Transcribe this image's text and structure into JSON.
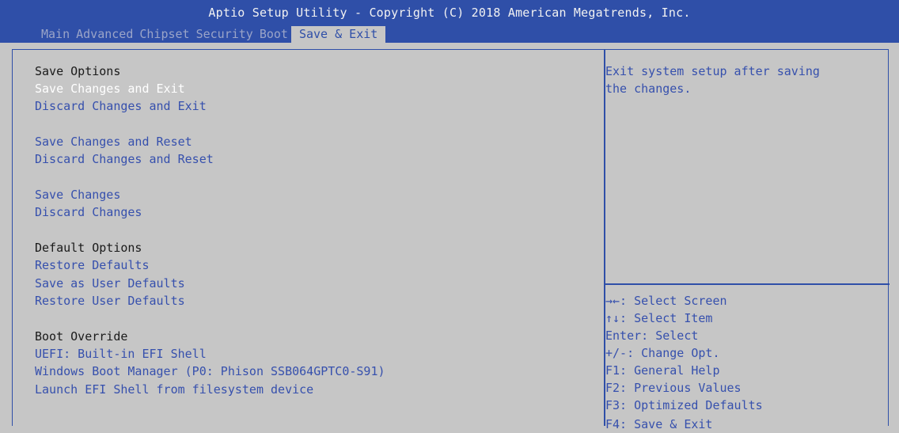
{
  "app": {
    "title": "Aptio Setup Utility - Copyright (C) 2018 American Megatrends, Inc."
  },
  "tabs": [
    {
      "label": "Main"
    },
    {
      "label": "Advanced"
    },
    {
      "label": "Chipset"
    },
    {
      "label": "Security"
    },
    {
      "label": "Boot"
    },
    {
      "label": "Save & Exit",
      "active": true
    }
  ],
  "menu": {
    "save_options_header": "Save Options",
    "save_changes_and_exit": "Save Changes and Exit",
    "discard_changes_and_exit": "Discard Changes and Exit",
    "save_changes_and_reset": "Save Changes and Reset",
    "discard_changes_and_reset": "Discard Changes and Reset",
    "save_changes": "Save Changes",
    "discard_changes": "Discard Changes",
    "default_options_header": "Default Options",
    "restore_defaults": "Restore Defaults",
    "save_as_user_defaults": "Save as User Defaults",
    "restore_user_defaults": "Restore User Defaults",
    "boot_override_header": "Boot Override",
    "uefi_builtin_efi_shell": "UEFI: Built-in EFI Shell",
    "windows_boot_manager": "Windows Boot Manager (P0: Phison SSB064GPTC0-S91)",
    "launch_efi_shell": "Launch EFI Shell from filesystem device"
  },
  "help": {
    "text": "Exit system setup after saving\nthe changes."
  },
  "keys": [
    "→←: Select Screen",
    "↑↓: Select Item",
    "Enter: Select",
    "+/-: Change Opt.",
    "F1: General Help",
    "F2: Previous Values",
    "F3: Optimized Defaults",
    "F4: Save & Exit"
  ],
  "colors": {
    "header_blue": "#2f4fa8",
    "background_gray": "#c6c6c6",
    "item_blue": "#3650ad",
    "selected_white": "#ffffff"
  }
}
